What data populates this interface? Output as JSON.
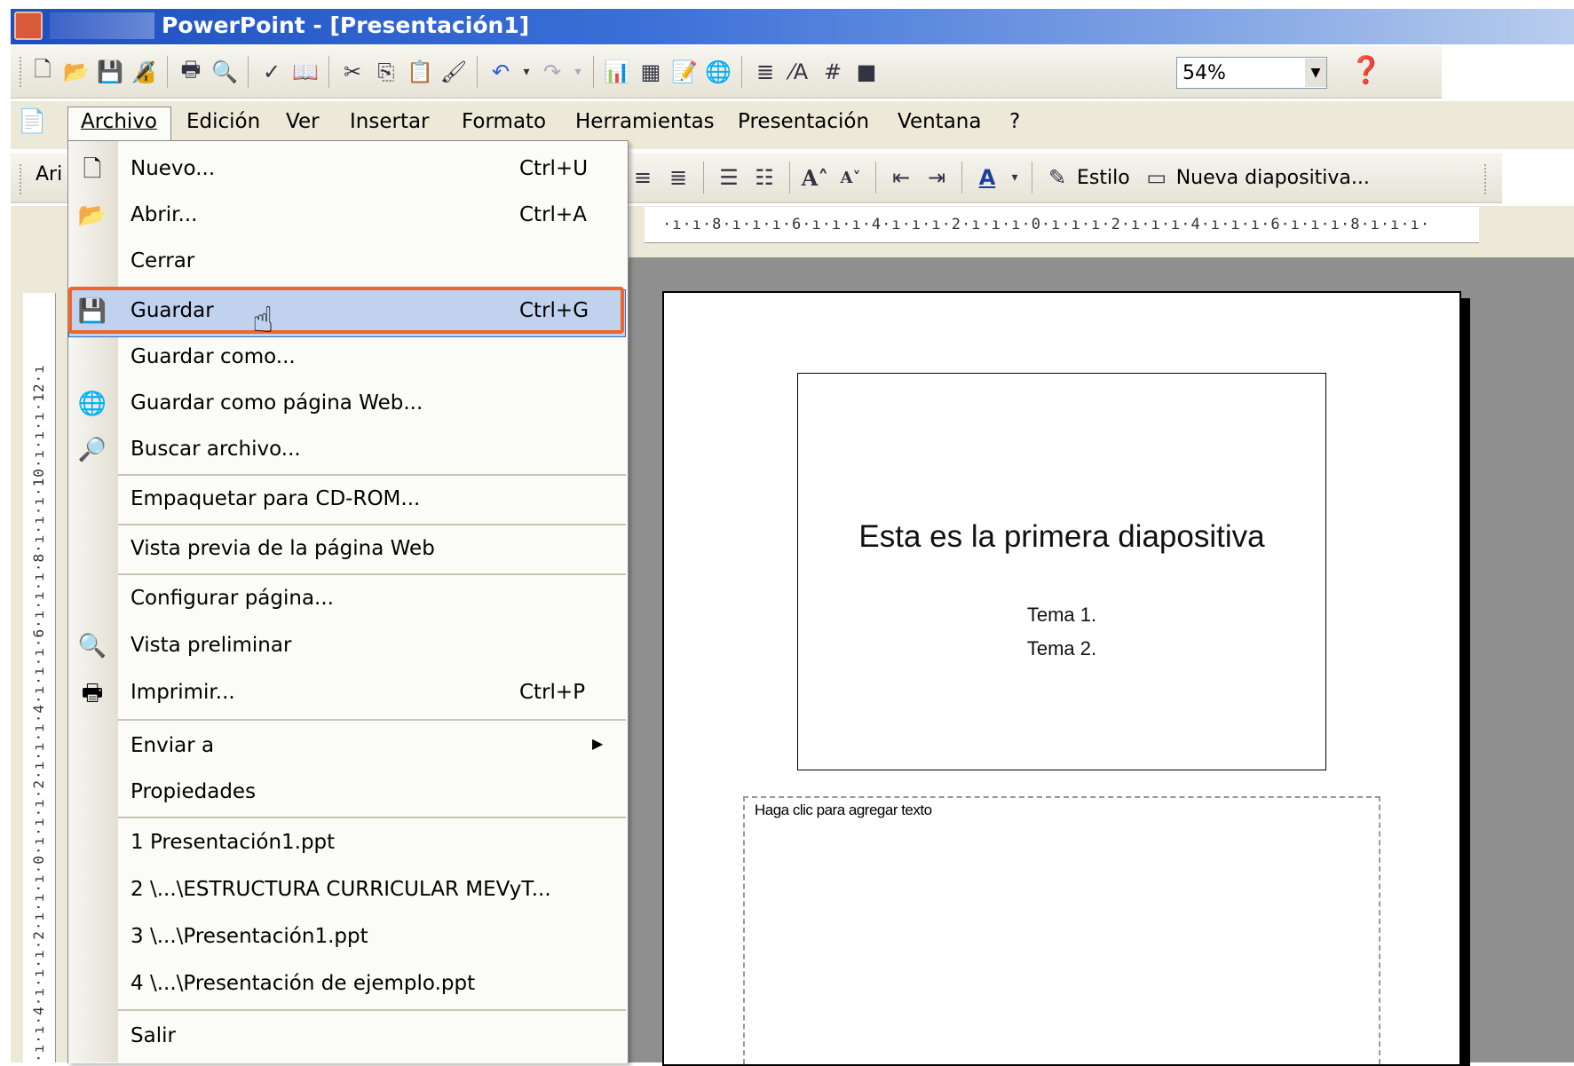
{
  "window": {
    "title": "PowerPoint - [Presentación1]"
  },
  "toolbar": {
    "zoom": "54%"
  },
  "menubar": {
    "items": [
      "Archivo",
      "Edición",
      "Ver",
      "Insertar",
      "Formato",
      "Herramientas",
      "Presentación",
      "Ventana",
      "?"
    ]
  },
  "formatting": {
    "font_partial": "Ari",
    "style_label": "Estilo",
    "new_slide_label": "Nueva diapositiva..."
  },
  "rulers": {
    "horizontal": "·ı·ı·8·ı·ı·ı·6·ı·ı·ı·4·ı·ı·ı·2·ı·ı·ı·0·ı·ı·ı·2·ı·ı·ı·4·ı·ı·ı·6·ı·ı·ı·8·ı·ı·ı·",
    "vertical": "·ı·ı·4·ı·ı·ı·2·ı·ı·ı·0·ı·ı·ı·2·ı·ı·ı·4·ı·ı·ı·6·ı·ı·ı·8·ı·ı·ı·10·ı·ı·ı·12·ı"
  },
  "file_menu": {
    "items": [
      {
        "label": "Nuevo...",
        "shortcut": "Ctrl+U",
        "icon": "new-document-icon"
      },
      {
        "label": "Abrir...",
        "shortcut": "Ctrl+A",
        "icon": "open-folder-icon"
      },
      {
        "label": "Cerrar",
        "shortcut": ""
      },
      {
        "label": "Guardar",
        "shortcut": "Ctrl+G",
        "icon": "save-icon"
      },
      {
        "label": "Guardar como...",
        "shortcut": ""
      },
      {
        "label": "Guardar como página Web...",
        "shortcut": "",
        "icon": "save-web-icon"
      },
      {
        "label": "Buscar archivo...",
        "shortcut": "",
        "icon": "search-file-icon"
      },
      {
        "label": "Empaquetar para CD-ROM...",
        "shortcut": ""
      },
      {
        "label": "Vista previa de la página Web",
        "shortcut": ""
      },
      {
        "label": "Configurar página...",
        "shortcut": ""
      },
      {
        "label": "Vista preliminar",
        "shortcut": "",
        "icon": "print-preview-icon"
      },
      {
        "label": "Imprimir...",
        "shortcut": "Ctrl+P",
        "icon": "print-icon"
      },
      {
        "label": "Enviar a",
        "shortcut": ""
      },
      {
        "label": "Propiedades",
        "shortcut": ""
      },
      {
        "label": "1 Presentación1.ppt",
        "shortcut": ""
      },
      {
        "label": "2 \\...\\ESTRUCTURA CURRICULAR MEVyT...",
        "shortcut": ""
      },
      {
        "label": "3 \\...\\Presentación1.ppt",
        "shortcut": ""
      },
      {
        "label": "4 \\...\\Presentación de ejemplo.ppt",
        "shortcut": ""
      },
      {
        "label": "Salir",
        "shortcut": ""
      }
    ]
  },
  "slide": {
    "title": "Esta es la primera diapositiva",
    "bullets": [
      "Tema 1.",
      "Tema 2."
    ]
  },
  "notes": {
    "placeholder": "Haga clic para agregar texto"
  },
  "colors": {
    "titlebar": "#1d4fbf",
    "highlight_frame": "#f0662a",
    "menu_highlight": "#c1d2ee"
  }
}
